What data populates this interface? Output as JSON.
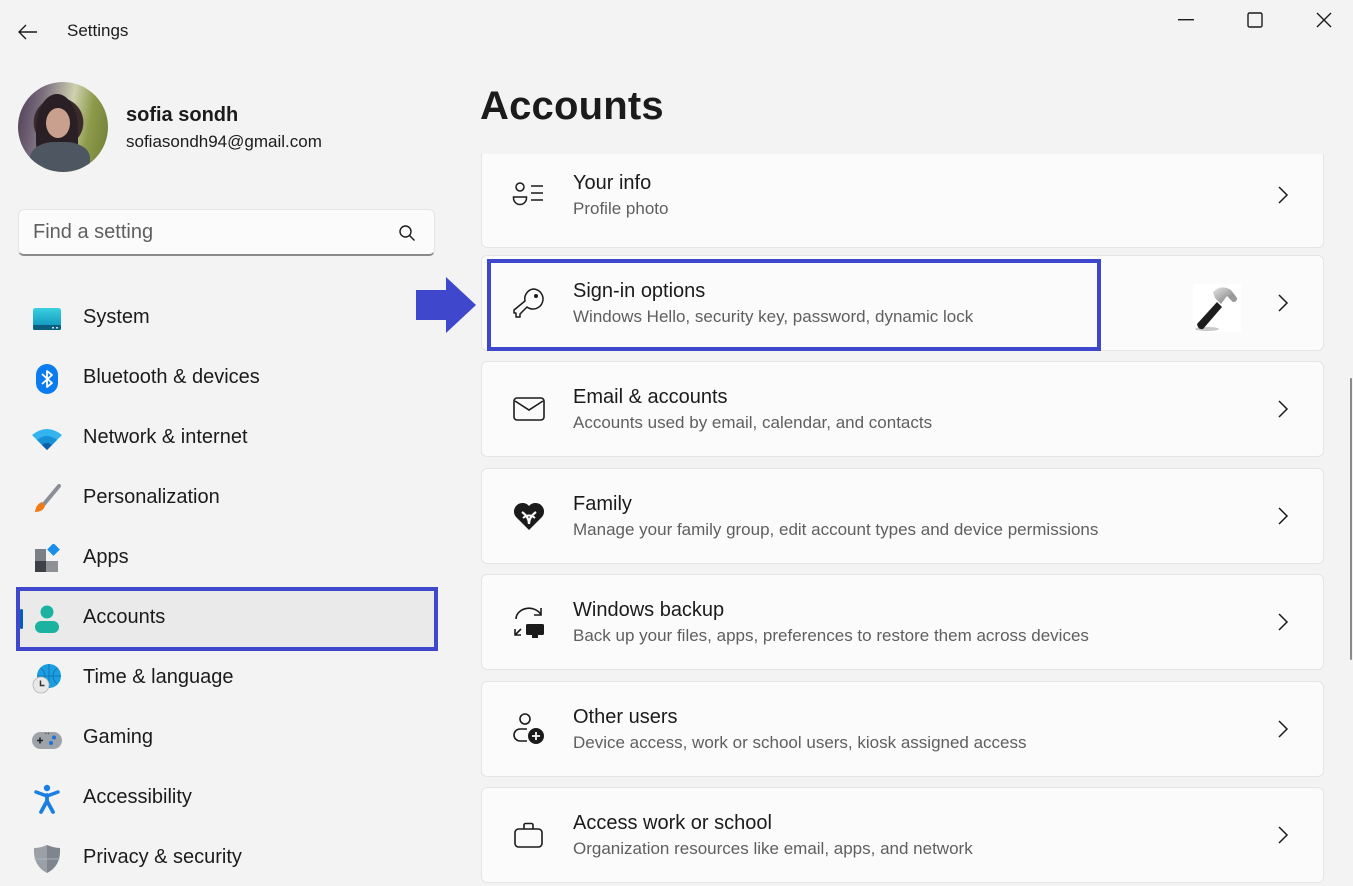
{
  "window": {
    "title": "Settings",
    "controls": {
      "minimize": "minimize",
      "maximize": "maximize",
      "close": "close"
    }
  },
  "profile": {
    "name": "sofia sondh",
    "email": "sofiasondh94@gmail.com"
  },
  "search": {
    "placeholder": "Find a setting",
    "value": ""
  },
  "sidebar": {
    "items": [
      {
        "label": "System",
        "icon": "system-icon",
        "selected": false
      },
      {
        "label": "Bluetooth & devices",
        "icon": "bluetooth-icon",
        "selected": false
      },
      {
        "label": "Network & internet",
        "icon": "wifi-icon",
        "selected": false
      },
      {
        "label": "Personalization",
        "icon": "paintbrush-icon",
        "selected": false
      },
      {
        "label": "Apps",
        "icon": "apps-icon",
        "selected": false
      },
      {
        "label": "Accounts",
        "icon": "accounts-icon",
        "selected": true
      },
      {
        "label": "Time & language",
        "icon": "time-language-icon",
        "selected": false
      },
      {
        "label": "Gaming",
        "icon": "gamepad-icon",
        "selected": false
      },
      {
        "label": "Accessibility",
        "icon": "accessibility-icon",
        "selected": false
      },
      {
        "label": "Privacy & security",
        "icon": "shield-icon",
        "selected": false
      }
    ]
  },
  "main": {
    "title": "Accounts",
    "cards": [
      {
        "title": "Your info",
        "subtitle": "Profile photo",
        "icon": "user-info-icon"
      },
      {
        "title": "Sign-in options",
        "subtitle": "Windows Hello, security key, password, dynamic lock",
        "icon": "key-icon"
      },
      {
        "title": "Email & accounts",
        "subtitle": "Accounts used by email, calendar, and contacts",
        "icon": "mail-icon"
      },
      {
        "title": "Family",
        "subtitle": "Manage your family group, edit account types and device permissions",
        "icon": "family-heart-icon"
      },
      {
        "title": "Windows backup",
        "subtitle": "Back up your files, apps, preferences to restore them across devices",
        "icon": "backup-sync-icon"
      },
      {
        "title": "Other users",
        "subtitle": "Device access, work or school users, kiosk assigned access",
        "icon": "add-user-icon"
      },
      {
        "title": "Access work or school",
        "subtitle": "Organization resources like email, apps, and network",
        "icon": "briefcase-icon"
      }
    ]
  },
  "annotations": {
    "highlight_color": "#3f48cc",
    "highlighted_nav": "Accounts",
    "highlighted_card": "Sign-in options",
    "overlay_image": "hammer-icon"
  },
  "colors": {
    "background": "#f3f3f3",
    "card": "#fbfbfb",
    "accent": "#005fb8"
  }
}
